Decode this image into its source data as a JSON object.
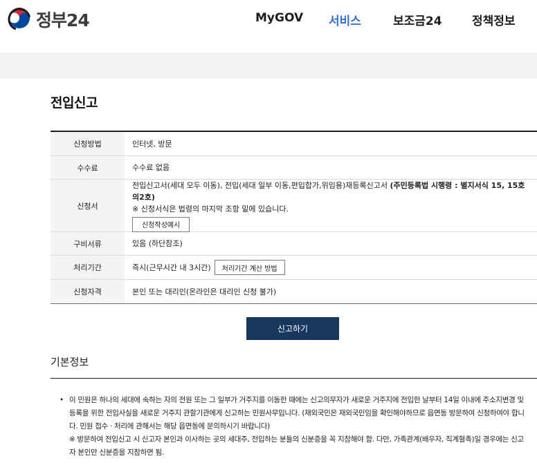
{
  "header": {
    "logo_text": "정부24",
    "nav": [
      {
        "label": "MyGOV",
        "active": false
      },
      {
        "label": "서비스",
        "active": true
      },
      {
        "label": "보조금24",
        "active": false
      },
      {
        "label": "정책정보",
        "active": false
      }
    ]
  },
  "page": {
    "title": "전입신고"
  },
  "table": {
    "rows": [
      {
        "label": "신청방법",
        "value": "인터넷, 방문"
      },
      {
        "label": "수수료",
        "value": "수수료 없음"
      },
      {
        "label": "신청서",
        "value_line1_normal": "전입신고서(세대 모두 이동), 전입(세대 일부 이동,편입합가,위임용)재등록신고서 ",
        "value_line1_bold": "(주민등록법 시행령 : 별지서식 15, 15호의2호)",
        "value_line2": "※ 신청서식은 법령의 마지막 조항 밑에 있습니다.",
        "button_label": "신청작성예시"
      },
      {
        "label": "구비서류",
        "value": "있음 (하단참조)"
      },
      {
        "label": "처리기간",
        "value": "즉시(근무시간 내 3시간)",
        "button_label": "처리기간 계산 방법"
      },
      {
        "label": "신청자격",
        "value": "본인 또는 대리인(온라인은 대리인 신청 불가)"
      }
    ]
  },
  "apply_button": "신고하기",
  "basic_info": {
    "title": "기본정보",
    "bullet": "•",
    "paragraph1": "이 민원은 하나의 세대에 속하는 자의 전원 또는 그 일부가 거주지를 이동한 때에는 신고의무자가 새로운 거주지에 전입한 날부터 14일 이내에 주소지변경 및 등록을 위한 전입사실을 새로운 거주지 관할기관에게 신고하는 민원사무입니다. (재외국민은 재외국민임을 확인해야하므로 읍면동 방문하여 신청하여야 합니다. 민원 접수 · 처리에 관해서는 해당 읍면동에 문의하시기 바랍니다)",
    "paragraph2": "※ 방문하여 전입신고 시 신고자 본인과 이사하는 곳의 세대주, 전입하는 분들의 신분증을 꼭 지참해야 함. 다만, 가족관계(배우자, 직계혈족)일 경우에는 신고자 본인만 신분증을 지참하면 됨."
  },
  "colors": {
    "accent_blue": "#2f6fd6",
    "apply_button_bg": "#18375d",
    "logo_red": "#cd2e3a",
    "logo_blue": "#0047a0"
  }
}
